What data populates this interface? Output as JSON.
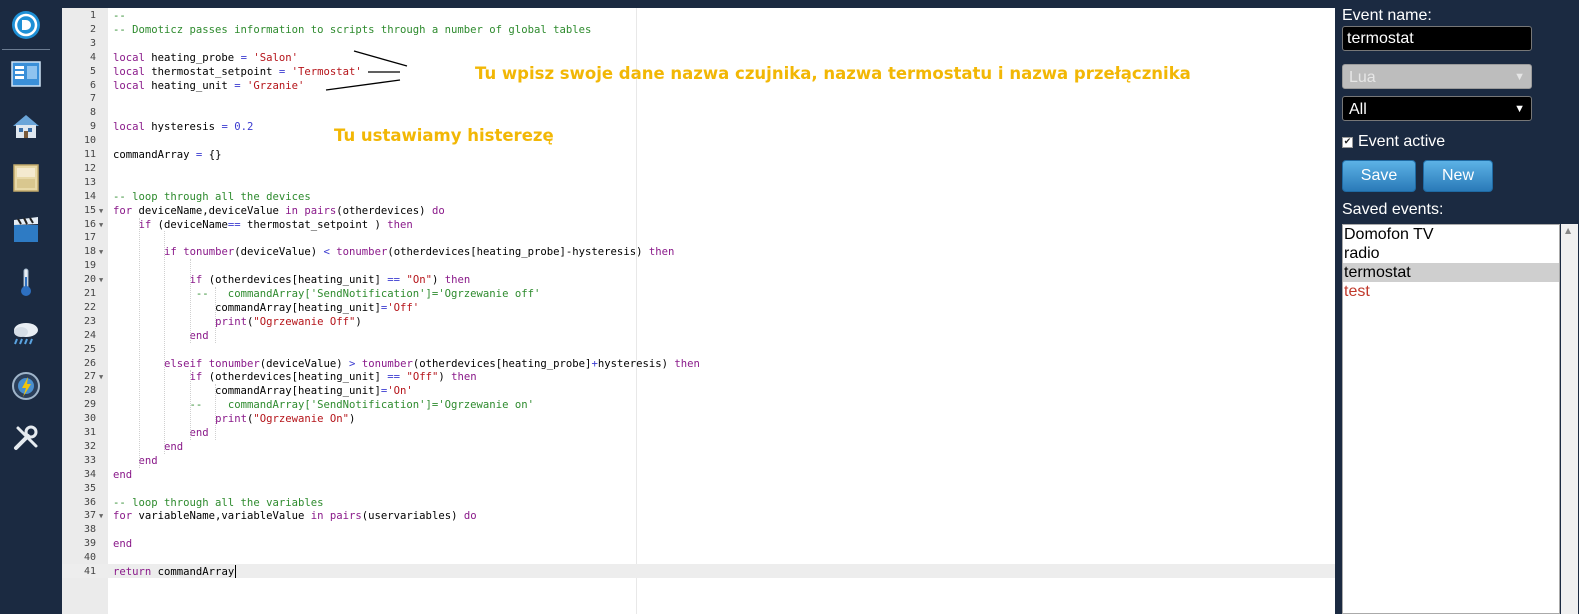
{
  "sidebar": {
    "icons": [
      {
        "name": "domoticz-logo-icon"
      },
      {
        "name": "dashboard-icon"
      },
      {
        "name": "home-icon"
      },
      {
        "name": "switches-icon"
      },
      {
        "name": "scenes-icon"
      },
      {
        "name": "temperature-icon"
      },
      {
        "name": "weather-icon"
      },
      {
        "name": "utility-icon"
      },
      {
        "name": "setup-icon"
      }
    ]
  },
  "editor": {
    "lines": [
      {
        "n": "1",
        "code": "--"
      },
      {
        "n": "2",
        "code": "-- Domoticz passes information to scripts through a number of global tables"
      },
      {
        "n": "3",
        "code": ""
      },
      {
        "n": "4",
        "code": "local heating_probe = 'Salon'"
      },
      {
        "n": "5",
        "code": "local thermostat_setpoint = 'Termostat'"
      },
      {
        "n": "6",
        "code": "local heating_unit = 'Grzanie'"
      },
      {
        "n": "7",
        "code": ""
      },
      {
        "n": "8",
        "code": ""
      },
      {
        "n": "9",
        "code": "local hysteresis = 0.2"
      },
      {
        "n": "10",
        "code": ""
      },
      {
        "n": "11",
        "code": "commandArray = {}"
      },
      {
        "n": "12",
        "code": ""
      },
      {
        "n": "13",
        "code": ""
      },
      {
        "n": "14",
        "code": "-- loop through all the devices"
      },
      {
        "n": "15",
        "code": "for deviceName,deviceValue in pairs(otherdevices) do",
        "fold": true
      },
      {
        "n": "16",
        "code": "    if (deviceName== thermostat_setpoint ) then",
        "fold": true
      },
      {
        "n": "17",
        "code": ""
      },
      {
        "n": "18",
        "code": "        if tonumber(deviceValue) < tonumber(otherdevices[heating_probe]-hysteresis) then",
        "fold": true
      },
      {
        "n": "19",
        "code": ""
      },
      {
        "n": "20",
        "code": "            if (otherdevices[heating_unit] == \"On\") then",
        "fold": true
      },
      {
        "n": "21",
        "code": "             --   commandArray['SendNotification']='Ogrzewanie off'"
      },
      {
        "n": "22",
        "code": "                commandArray[heating_unit]='Off'"
      },
      {
        "n": "23",
        "code": "                print(\"Ogrzewanie Off\")"
      },
      {
        "n": "24",
        "code": "            end"
      },
      {
        "n": "25",
        "code": ""
      },
      {
        "n": "26",
        "code": "        elseif tonumber(deviceValue) > tonumber(otherdevices[heating_probe]+hysteresis) then"
      },
      {
        "n": "27",
        "code": "            if (otherdevices[heating_unit] == \"Off\") then",
        "fold": true
      },
      {
        "n": "28",
        "code": "                commandArray[heating_unit]='On'"
      },
      {
        "n": "29",
        "code": "            --    commandArray['SendNotification']='Ogrzewanie on'"
      },
      {
        "n": "30",
        "code": "                print(\"Ogrzewanie On\")"
      },
      {
        "n": "31",
        "code": "            end"
      },
      {
        "n": "32",
        "code": "        end"
      },
      {
        "n": "33",
        "code": "    end"
      },
      {
        "n": "34",
        "code": "end"
      },
      {
        "n": "35",
        "code": ""
      },
      {
        "n": "36",
        "code": "-- loop through all the variables"
      },
      {
        "n": "37",
        "code": "for variableName,variableValue in pairs(uservariables) do",
        "fold": true
      },
      {
        "n": "38",
        "code": ""
      },
      {
        "n": "39",
        "code": "end"
      },
      {
        "n": "40",
        "code": ""
      },
      {
        "n": "41",
        "code": "return commandArray"
      }
    ],
    "annotation_1": "Tu wpisz swoje dane nazwa czujnika, nazwa termostatu i nazwa przełącznika",
    "annotation_2": "Tu ustawiamy histerezę",
    "annotation_color": "#f2b705"
  },
  "panel": {
    "event_name_label": "Event name:",
    "event_name_value": "termostat",
    "language_select": "Lua",
    "filter_select": "All",
    "event_active_label": "Event active",
    "event_active_checked": true,
    "save_label": "Save",
    "new_label": "New",
    "saved_events_label": "Saved events:",
    "saved_events": [
      {
        "label": "Domofon TV",
        "selected": false,
        "inactive": false
      },
      {
        "label": "radio",
        "selected": false,
        "inactive": false
      },
      {
        "label": "termostat",
        "selected": true,
        "inactive": false
      },
      {
        "label": "test",
        "selected": false,
        "inactive": true
      }
    ]
  }
}
